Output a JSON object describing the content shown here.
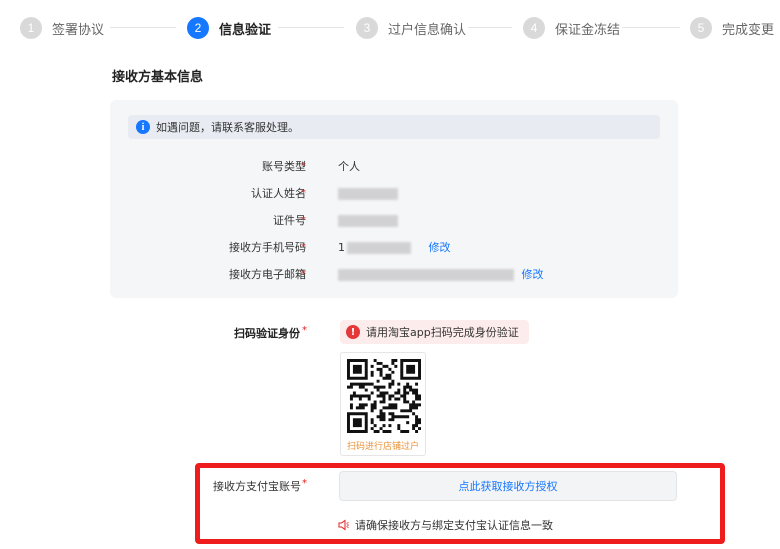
{
  "stepper": {
    "steps": [
      {
        "num": "1",
        "label": "签署协议"
      },
      {
        "num": "2",
        "label": "信息验证"
      },
      {
        "num": "3",
        "label": "过户信息确认"
      },
      {
        "num": "4",
        "label": "保证金冻结"
      },
      {
        "num": "5",
        "label": "完成变更"
      }
    ]
  },
  "section": {
    "title": "接收方基本信息"
  },
  "notice": {
    "text": "如遇问题，请联系客服处理。"
  },
  "fields": {
    "account_type": {
      "label": "账号类型",
      "value": "个人"
    },
    "cert_name": {
      "label": "认证人姓名"
    },
    "cert_id": {
      "label": "证件号"
    },
    "phone": {
      "label": "接收方手机号码",
      "value_prefix": "1",
      "edit": "修改"
    },
    "email": {
      "label": "接收方电子邮箱",
      "edit": "修改"
    }
  },
  "scan": {
    "label": "扫码验证身份",
    "warning": "请用淘宝app扫码完成身份验证",
    "qr_caption": "扫码进行店铺过户"
  },
  "alipay": {
    "label": "接收方支付宝账号",
    "button": "点此获取接收方授权",
    "tip": "请确保接收方与绑定支付宝认证信息一致"
  },
  "required_mark": "*",
  "colors": {
    "accent": "#1677ff",
    "highlight": "#ee1c1c",
    "required": "#e02020"
  }
}
